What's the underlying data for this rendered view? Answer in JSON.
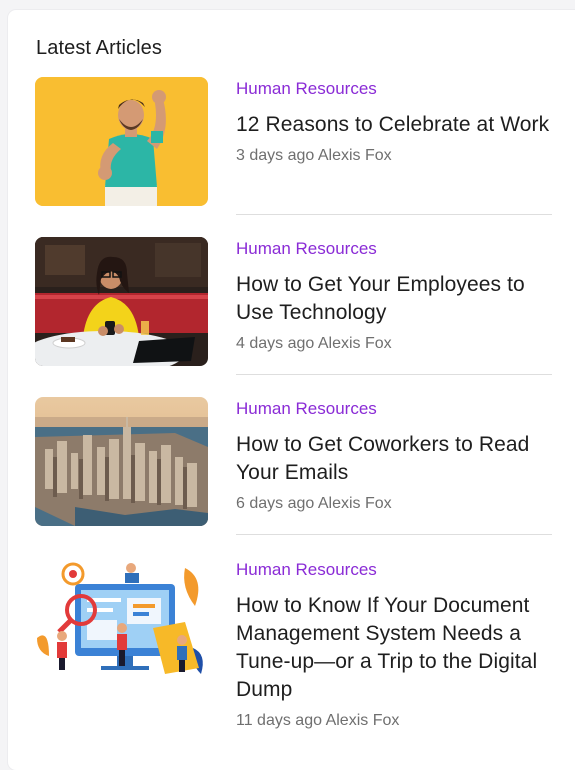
{
  "section_title": "Latest Articles",
  "articles": [
    {
      "category": "Human Resources",
      "title": "12 Reasons to Celebrate at Work",
      "age": "3 days ago",
      "author": "Alexis Fox"
    },
    {
      "category": "Human Resources",
      "title": "How to Get Your Employees to Use Technology",
      "age": "4 days ago",
      "author": "Alexis Fox"
    },
    {
      "category": "Human Resources",
      "title": "How to Get Coworkers to Read Your Emails",
      "age": "6 days ago",
      "author": "Alexis Fox"
    },
    {
      "category": "Human Resources",
      "title": "How to Know If Your Document Management System Needs a Tune-up—or a Trip to the Digital Dump",
      "age": "11 days ago",
      "author": "Alexis Fox"
    }
  ],
  "colors": {
    "category": "#8a2bd6",
    "title": "#1e1e1e",
    "byline": "#6f6f6f",
    "divider": "#dedede"
  }
}
